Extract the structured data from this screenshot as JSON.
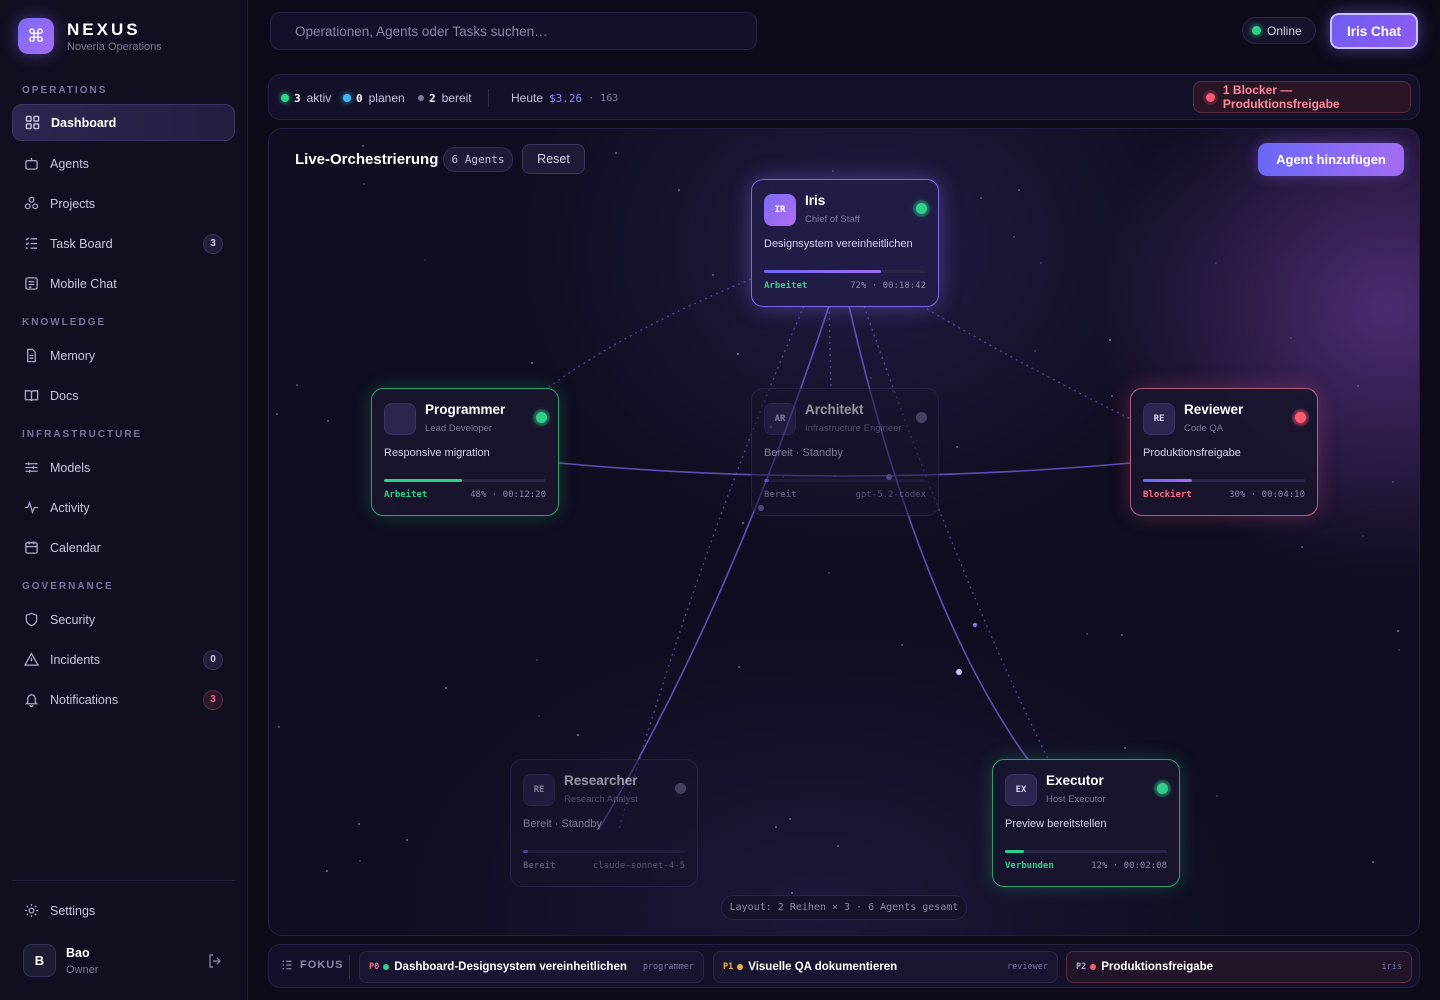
{
  "brand": {
    "name": "NEXUS",
    "sub": "Noveria Operations",
    "logo_icon": "command-icon"
  },
  "sidebar": {
    "sections": [
      {
        "label": "OPERATIONS"
      },
      {
        "label": "KNOWLEDGE"
      },
      {
        "label": "INFRASTRUCTURE"
      },
      {
        "label": "GOVERNANCE"
      }
    ],
    "items": [
      {
        "label": "Dashboard",
        "icon": "grid-icon",
        "active": true
      },
      {
        "label": "Agents",
        "icon": "bot-icon"
      },
      {
        "label": "Projects",
        "icon": "network-icon"
      },
      {
        "label": "Task Board",
        "icon": "list-icon",
        "badge": "3"
      },
      {
        "label": "Mobile Chat",
        "icon": "message-icon"
      },
      {
        "label": "Memory",
        "icon": "document-icon"
      },
      {
        "label": "Docs",
        "icon": "book-icon"
      },
      {
        "label": "Models",
        "icon": "sliders-icon"
      },
      {
        "label": "Activity",
        "icon": "activity-icon"
      },
      {
        "label": "Calendar",
        "icon": "calendar-icon"
      },
      {
        "label": "Security",
        "icon": "shield-icon"
      },
      {
        "label": "Incidents",
        "icon": "alert-icon",
        "badge": "0"
      },
      {
        "label": "Notifications",
        "icon": "bell-icon",
        "badge": "3"
      }
    ],
    "settings": "Settings",
    "user": {
      "initial": "B",
      "name": "Bao",
      "role": "Owner"
    }
  },
  "header": {
    "search_placeholder": "Operationen, Agents oder Tasks suchen…",
    "online": "Online",
    "iris_chat": "Iris Chat"
  },
  "stats": {
    "active_count": "3",
    "active_label": "aktiv",
    "planning_count": "0",
    "planning_label": "planen",
    "ready_count": "2",
    "ready_label": "bereit",
    "today_label": "Heute",
    "today_cost": "$3.26",
    "today_extra": "· 163",
    "blocker": "1 Blocker — Produktionsfreigabe"
  },
  "canvas": {
    "title": "Live-Orchestrierung",
    "agent_count": "6 Agents",
    "reset": "Reset",
    "add_agent": "Agent hinzufügen",
    "layout_info": "Layout: 2 Reihen × 3 · 6 Agents gesamt"
  },
  "agents": {
    "iris": {
      "badge": "IR",
      "name": "Iris",
      "role": "Chief of Staff",
      "task": "Designsystem vereinheitlichen",
      "state": "Arbeitet",
      "meta": "72% · 00:18:42",
      "progress": 0.72
    },
    "programmer": {
      "badge": "",
      "name": "Programmer",
      "role": "Lead Developer",
      "task": "Responsive migration",
      "state": "Arbeitet",
      "meta": "48% · 00:12:20",
      "progress": 0.48
    },
    "architekt": {
      "badge": "AR",
      "name": "Architekt",
      "role": "Infrastructure Engineer",
      "task": "Bereit · Standby",
      "state": "Bereit",
      "meta": "gpt-5.2-codex",
      "progress": 0.03
    },
    "reviewer": {
      "badge": "RE",
      "name": "Reviewer",
      "role": "Code QA",
      "task": "Produktionsfreigabe",
      "state": "Blockiert",
      "meta": "30% · 00:04:10",
      "progress": 0.3
    },
    "researcher": {
      "badge": "RE",
      "name": "Researcher",
      "role": "Research Analyst",
      "task": "Bereit · Standby",
      "state": "Bereit",
      "meta": "claude-sonnet-4-5",
      "progress": 0.03
    },
    "executor": {
      "badge": "EX",
      "name": "Executor",
      "role": "Host Executor",
      "task": "Preview bereitstellen",
      "state": "Verbunden",
      "meta": "12% · 00:02:08",
      "progress": 0.12
    }
  },
  "colors": {
    "accent": "#7b6cf6",
    "green": "#2fd08a",
    "red": "#ff5a72",
    "amber": "#f0b03c"
  },
  "focus": {
    "label": "FOKUS",
    "items": [
      {
        "prio": "P0",
        "title": "Dashboard-Designsystem vereinheitlichen",
        "owner": "programmer"
      },
      {
        "prio": "P1",
        "title": "Visuelle QA dokumentieren",
        "owner": "reviewer"
      },
      {
        "prio": "P2",
        "title": "Produktionsfreigabe",
        "owner": "iris"
      }
    ]
  }
}
